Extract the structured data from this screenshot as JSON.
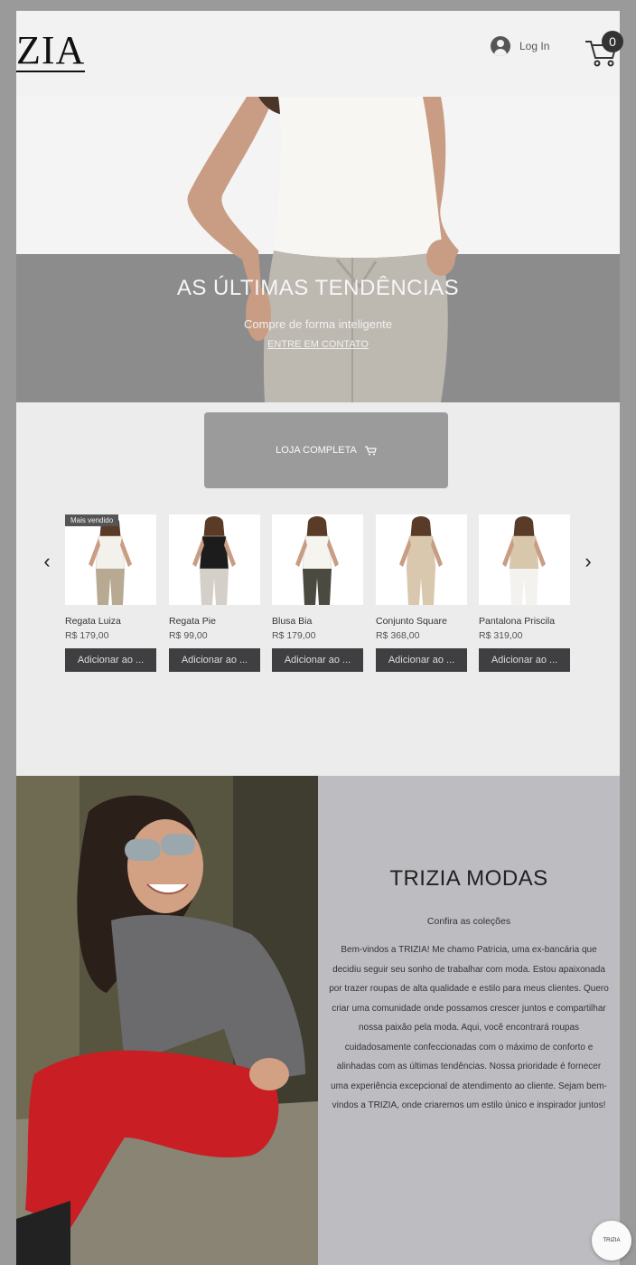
{
  "header": {
    "logo": "ZIA",
    "login_label": "Log In",
    "cart_count": "0"
  },
  "hero": {
    "title": "AS ÚLTIMAS TENDÊNCIAS",
    "subtitle": "Compre de forma inteligente",
    "link": "ENTRE EM CONTATO"
  },
  "shop": {
    "button_label": "LOJA COMPLETA"
  },
  "products": [
    {
      "badge": "Mais vendido",
      "name": "Regata Luiza",
      "price": "R$ 179,00",
      "button": "Adicionar ao ...",
      "top_color": "#f3f1ec",
      "bottom_color": "#b7a992"
    },
    {
      "badge": "",
      "name": "Regata Pie",
      "price": "R$ 99,00",
      "button": "Adicionar ao ...",
      "top_color": "#1c1c1c",
      "bottom_color": "#d4cfc8"
    },
    {
      "badge": "",
      "name": "Blusa Bia",
      "price": "R$ 179,00",
      "button": "Adicionar ao ...",
      "top_color": "#f6f4ef",
      "bottom_color": "#4a4a40"
    },
    {
      "badge": "",
      "name": "Conjunto Square",
      "price": "R$ 368,00",
      "button": "Adicionar ao ...",
      "top_color": "#d9c7ae",
      "bottom_color": "#d9c7ae"
    },
    {
      "badge": "",
      "name": "Pantalona Priscila",
      "price": "R$ 319,00",
      "button": "Adicionar ao ...",
      "top_color": "#d8c7ab",
      "bottom_color": "#f4f2ee"
    }
  ],
  "about": {
    "title": "TRIZIA MODAS",
    "subtitle": "Confira as coleções",
    "body": "Bem-vindos a TRIZIA! Me chamo Patricia, uma ex-bancária que decidiu seguir seu sonho de trabalhar com moda. Estou apaixonada por trazer roupas de alta qualidade e estilo para meus clientes. Quero criar uma comunidade onde possamos crescer juntos e compartilhar nossa paixão pela moda. Aqui, você encontrará roupas cuidadosamente confeccionadas com o máximo de conforto e alinhadas com as últimas tendências. Nossa prioridade é fornecer uma experiência excepcional de atendimento ao cliente. Sejam bem-vindos a TRIZIA, onde criaremos um estilo único e inspirador juntos!"
  },
  "chat": {
    "label": "TRIZIA"
  },
  "colors": {
    "page_bg": "#ececec",
    "hero_band": "#8c8c8c",
    "button_dark": "#3f3f42",
    "about_panel": "#bdbdc1"
  }
}
